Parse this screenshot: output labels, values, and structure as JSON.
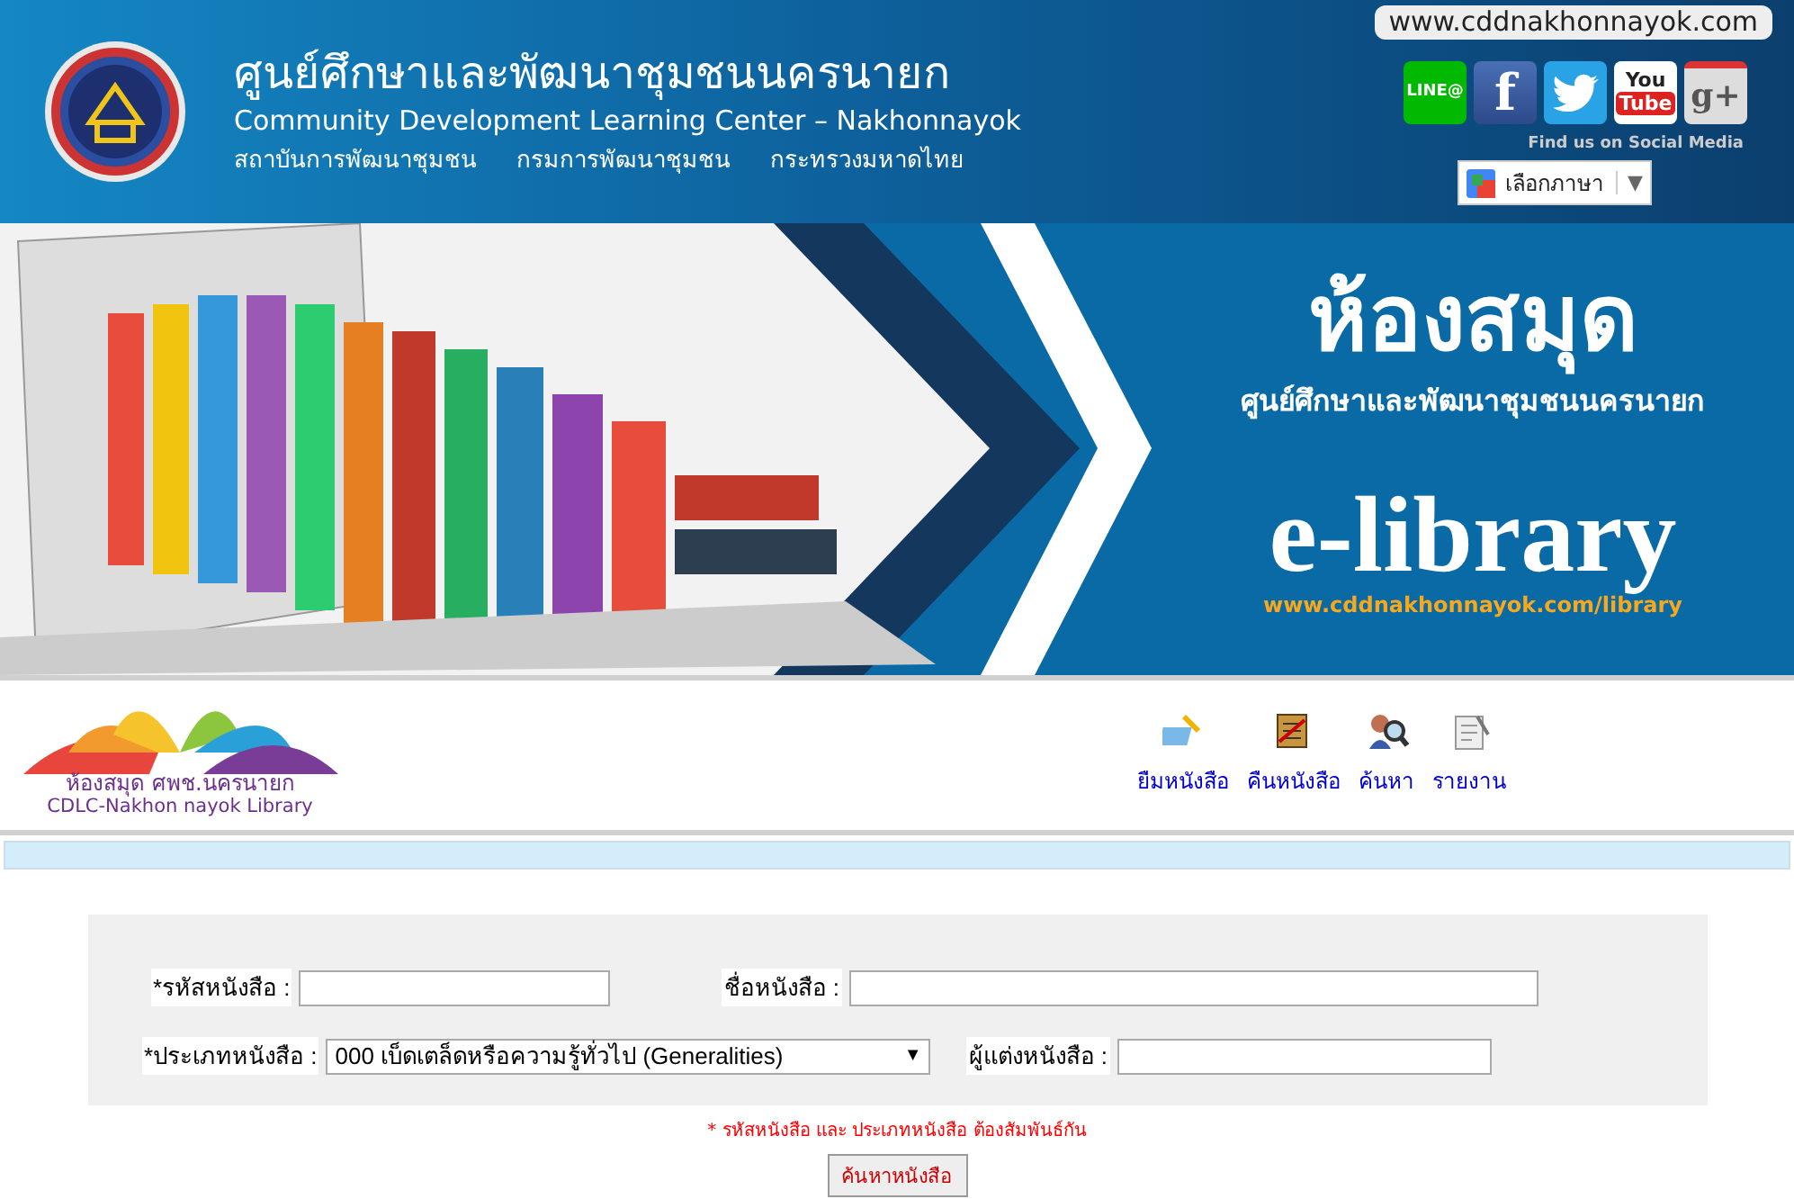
{
  "header": {
    "title_th": "ศูนย์ศึกษาและพัฒนาชุมชนนครนายก",
    "title_en": "Community Development Learning Center – Nakhonnayok",
    "units": [
      "สถาบันการพัฒนาชุมชน",
      "กรมการพัฒนาชุมชน",
      "กระทรวงมหาดไทย"
    ],
    "site_url": "www.cddnakhonnayok.com",
    "social": [
      {
        "kind": "line",
        "label": "LINE@"
      },
      {
        "kind": "facebook",
        "label": "f"
      },
      {
        "kind": "twitter"
      },
      {
        "kind": "youtube",
        "label": "You",
        "label_2": "Tube"
      },
      {
        "kind": "google",
        "label": "g+"
      }
    ],
    "social_caption": "Find us on Social Media",
    "translate": {
      "label": "เลือกภาษา",
      "arrow": "▼"
    }
  },
  "banner": {
    "title": "ห้องสมุด",
    "subtitle": "ศูนย์ศึกษาและพัฒนาชุมชนนครนายก",
    "brand": "e-library",
    "url": "www.cddnakhonnayok.com/library"
  },
  "library": {
    "name_th": "ห้องสมุด ศพช.นครนายก",
    "name_en": "CDLC-Nakhon nayok Library",
    "menu": [
      {
        "kind": "borrow",
        "label": "ยืมหนังสือ"
      },
      {
        "kind": "return",
        "label": "คืนหนังสือ"
      },
      {
        "kind": "search",
        "label": "ค้นหา"
      },
      {
        "kind": "report",
        "label": "รายงาน"
      }
    ]
  },
  "form": {
    "book_code_label": "*รหัสหนังสือ :",
    "book_title_label": "ชื่อหนังสือ :",
    "category_label": "*ประเภทหนังสือ :",
    "category_value": "000 เบ็ดเตล็ดหรือความรู้ทั่วไป (Generalities)",
    "author_label": "ผู้แต่งหนังสือ :",
    "note": "* รหัสหนังสือ และ ประเภทหนังสือ ต้องสัมพันธ์กัน",
    "submit": "ค้นหาหนังสือ"
  }
}
